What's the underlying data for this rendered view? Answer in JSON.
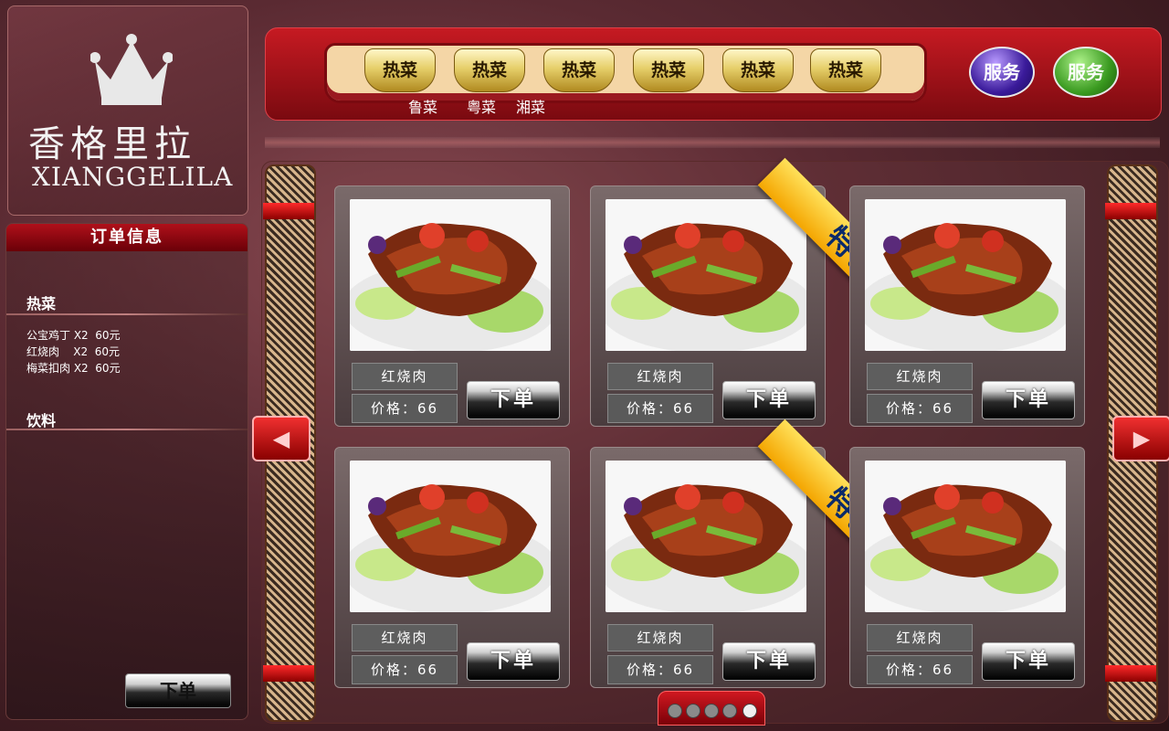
{
  "logo": {
    "name_cn": "香格里拉",
    "name_en": "XIANGGELILA"
  },
  "order_panel": {
    "title": "订单信息",
    "sections": [
      {
        "title": "热菜",
        "items": [
          "公宝鸡丁 X2  60元",
          "红烧肉    X2  60元",
          "梅菜扣肉 X2  60元"
        ]
      },
      {
        "title": "饮料",
        "items": []
      }
    ],
    "submit_label": "下单"
  },
  "nav": {
    "tabs": [
      "热菜",
      "热菜",
      "热菜",
      "热菜",
      "热菜",
      "热菜"
    ],
    "sub_categories": [
      "鲁菜",
      "粤菜",
      "湘菜"
    ],
    "service_buttons": [
      "服务",
      "服务"
    ]
  },
  "dishes": [
    {
      "name": "红烧肉",
      "price": "价格：66",
      "order_label": "下单",
      "badge": ""
    },
    {
      "name": "红烧肉",
      "price": "价格：66",
      "order_label": "下单",
      "badge": "特色"
    },
    {
      "name": "红烧肉",
      "price": "价格：66",
      "order_label": "下单",
      "badge": ""
    },
    {
      "name": "红烧肉",
      "price": "价格：66",
      "order_label": "下单",
      "badge": ""
    },
    {
      "name": "红烧肉",
      "price": "价格：66",
      "order_label": "下单",
      "badge": "特色"
    },
    {
      "name": "红烧肉",
      "price": "价格：66",
      "order_label": "下单",
      "badge": ""
    }
  ],
  "pager": {
    "pages": 5,
    "current": 5
  },
  "icons": {
    "prev": "left-arrow-icon",
    "next": "right-arrow-icon",
    "logo": "crown-icon"
  },
  "colors": {
    "accent": "#c61a22",
    "badge": "#f4a500"
  }
}
